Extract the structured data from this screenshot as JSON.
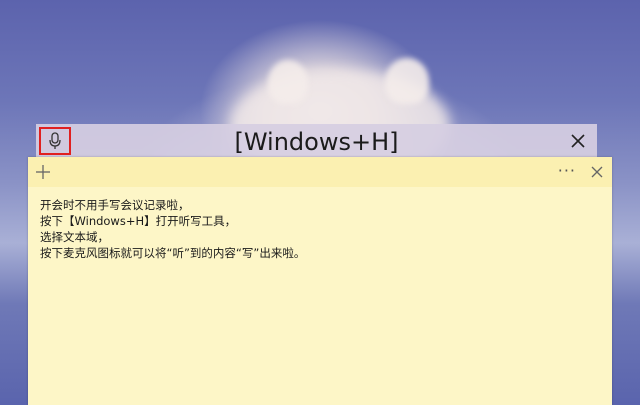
{
  "dictation": {
    "title": "[Windows+H]"
  },
  "note": {
    "more_label": "···",
    "lines": [
      "开会时不用手写会议记录啦，",
      "按下【Windows+H】打开听写工具，",
      "选择文本域，",
      "按下麦克风图标就可以将“听”到的内容“写”出来啦。"
    ]
  },
  "icons": {
    "mic": "microphone-icon",
    "close": "close-icon",
    "add": "plus-icon",
    "more": "more-icon"
  },
  "colors": {
    "highlight": "#e02020",
    "note_bg": "#fdf6c7",
    "note_toolbar": "#fbf0b1"
  }
}
